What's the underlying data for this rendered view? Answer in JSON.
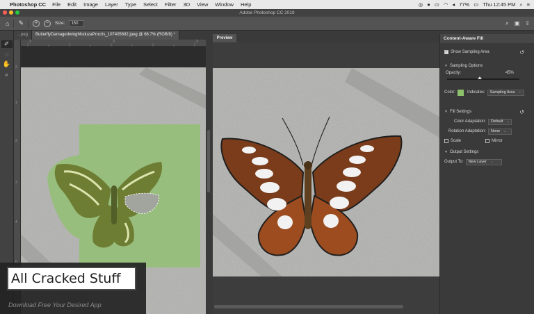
{
  "menubar": {
    "app_name": "Photoshop CC",
    "items": [
      "File",
      "Edit",
      "Image",
      "Layer",
      "Type",
      "Select",
      "Filter",
      "3D",
      "View",
      "Window",
      "Help"
    ],
    "battery": "77%",
    "clock": "Thu 12:45 PM"
  },
  "window_title": "Adobe Photoshop CC 2019",
  "options": {
    "size_label": "Size:",
    "size_value": "150"
  },
  "document_tabs": [
    {
      "label": "...peg",
      "active": false
    },
    {
      "label": "ButterflyDamagedwingModuzaProcris_107405682.jpeg @ 66.7% (RGB/8) *",
      "active": true
    }
  ],
  "ruler": {
    "h_ticks": [
      "3",
      "3",
      "3"
    ],
    "v_ticks": [
      "2",
      "1",
      "2",
      "3",
      "4",
      "5"
    ]
  },
  "preview": {
    "tab_label": "Preview"
  },
  "content_aware_fill": {
    "title": "Content-Aware Fill",
    "show_sampling_area": "Show Sampling Area",
    "sampling_options": "Sampling Options",
    "opacity_label": "Opacity:",
    "opacity_value": "45%",
    "opacity_level": 0.45,
    "color_label": "Color:",
    "sampling_color": "#8dc26a",
    "indicates_label": "Indicates:",
    "indicates_value": "Sampling Area",
    "fill_settings": "Fill Settings",
    "color_adaptation_label": "Color Adaptation:",
    "color_adaptation_value": "Default",
    "rotation_adaptation_label": "Rotation Adaptation:",
    "rotation_adaptation_value": "None",
    "scale_label": "Scale",
    "mirror_label": "Mirror",
    "output_settings": "Output Settings",
    "output_to_label": "Output To:",
    "output_to_value": "New Layer"
  },
  "watermark": {
    "title": "All Cracked Stuff",
    "subtitle": "Download Free Your Desired App"
  }
}
